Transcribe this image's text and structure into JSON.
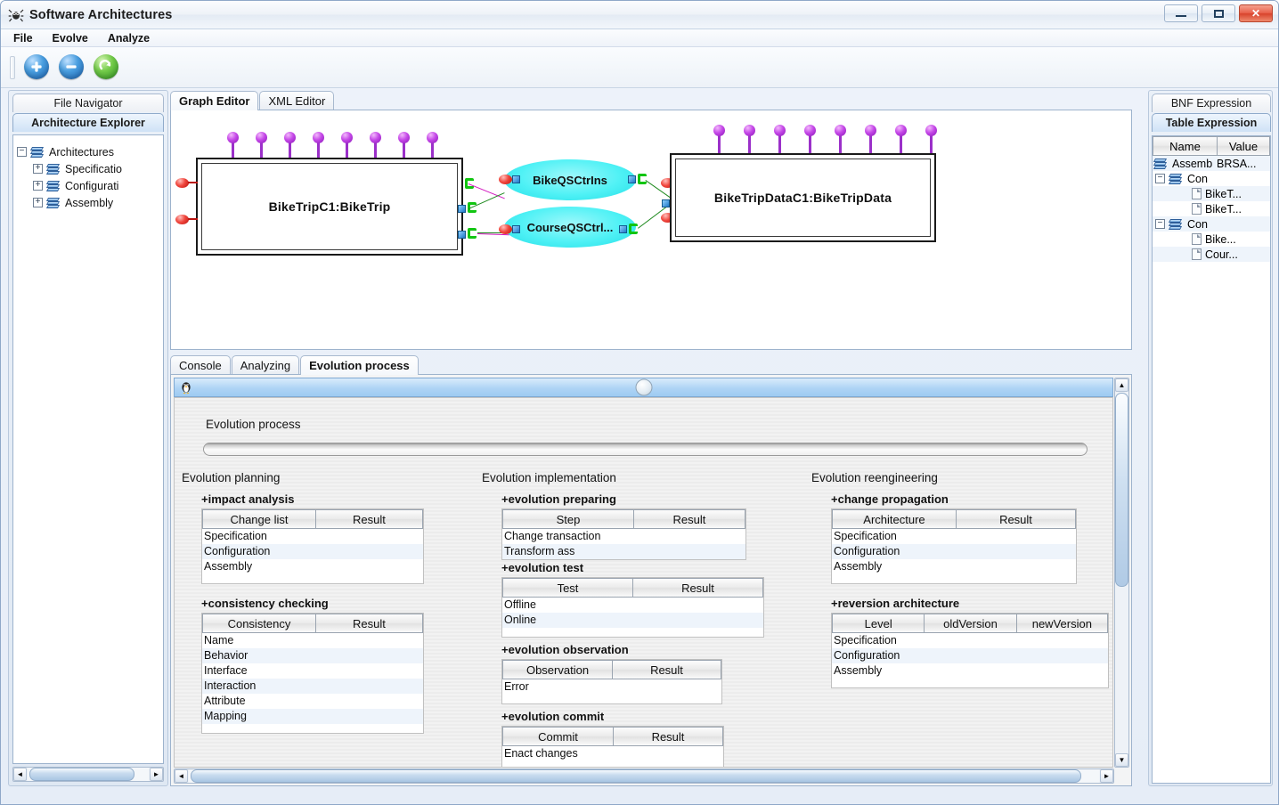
{
  "window": {
    "title": "Software Architectures",
    "app_icon": "spider-icon",
    "controls": {
      "minimize": "–",
      "maximize": "▣",
      "close": "✕"
    }
  },
  "menubar": {
    "items": [
      "File",
      "Evolve",
      "Analyze"
    ]
  },
  "toolbar": {
    "buttons": [
      {
        "name": "add-button",
        "icon": "plus-circle-icon"
      },
      {
        "name": "remove-button",
        "icon": "minus-circle-icon"
      },
      {
        "name": "refresh-button",
        "icon": "refresh-circle-icon"
      }
    ]
  },
  "left_panel": {
    "tabs": [
      {
        "label": "File Navigator",
        "selected": false
      },
      {
        "label": "Architecture Explorer",
        "selected": true
      }
    ],
    "tree": [
      {
        "label": "Architectures",
        "expander": "−",
        "level": 0,
        "icon": "stack-icon"
      },
      {
        "label": "Specificatio",
        "expander": "+",
        "level": 1,
        "icon": "stack-icon"
      },
      {
        "label": "Configurati",
        "expander": "+",
        "level": 1,
        "icon": "stack-icon"
      },
      {
        "label": "Assembly",
        "expander": "+",
        "level": 1,
        "icon": "stack-icon"
      }
    ]
  },
  "editor": {
    "tabs": [
      {
        "label": "Graph Editor",
        "selected": true
      },
      {
        "label": "XML Editor",
        "selected": false
      }
    ],
    "graph": {
      "components": [
        {
          "label": "BikeTripC1:BikeTrip",
          "shape": "rect"
        },
        {
          "label": "BikeTripDataC1:BikeTripData",
          "shape": "rect"
        }
      ],
      "connectors": [
        {
          "label": "BikeQSCtrIns",
          "shape": "ellipse"
        },
        {
          "label": "CourseQSCtrl...",
          "shape": "ellipse"
        }
      ]
    }
  },
  "bottom": {
    "tabs": [
      {
        "label": "Console",
        "selected": false
      },
      {
        "label": "Analyzing",
        "selected": false
      },
      {
        "label": "Evolution process",
        "selected": true
      }
    ],
    "internal_window": {
      "icon": "penguin-icon",
      "heading": "Evolution process",
      "progress": 0
    },
    "columns": [
      {
        "title": "Evolution planning",
        "sections": [
          {
            "title": "+impact analysis",
            "headers": [
              "Change list",
              "Result"
            ],
            "rows": [
              "Specification",
              "Configuration",
              "Assembly"
            ]
          },
          {
            "title": "+consistency checking",
            "headers": [
              "Consistency",
              "Result"
            ],
            "rows": [
              "Name",
              "Behavior",
              "Interface",
              "Interaction",
              "Attribute",
              "Mapping"
            ]
          }
        ]
      },
      {
        "title": "Evolution implementation",
        "sections": [
          {
            "title": "+evolution preparing",
            "headers": [
              "Step",
              "Result"
            ],
            "rows": [
              "Change transaction",
              "Transform ass"
            ]
          },
          {
            "title": "+evolution test",
            "headers": [
              "Test",
              "Result"
            ],
            "rows": [
              "Offline",
              "Online"
            ]
          },
          {
            "title": "+evolution observation",
            "headers": [
              "Observation",
              "Result"
            ],
            "rows": [
              "Error"
            ]
          },
          {
            "title": "+evolution commit",
            "headers": [
              "Commit",
              "Result"
            ],
            "rows": [
              "Enact changes"
            ]
          }
        ]
      },
      {
        "title": "Evolution reengineering",
        "sections": [
          {
            "title": "+change propagation",
            "headers": [
              "Architecture",
              "Result"
            ],
            "rows": [
              "Specification",
              "Configuration",
              "Assembly"
            ]
          },
          {
            "title": "+reversion architecture",
            "headers": [
              "Level",
              "oldVersion",
              "newVersion"
            ],
            "rows": [
              "Specification",
              "Configuration",
              "Assembly"
            ]
          }
        ]
      }
    ]
  },
  "right_panel": {
    "tabs": [
      {
        "label": "BNF Expression",
        "selected": false
      },
      {
        "label": "Table Expression",
        "selected": true
      }
    ],
    "table": {
      "headers": [
        "Name",
        "Value"
      ],
      "rows": [
        {
          "name": "Assemb",
          "value": "BRSA...",
          "level": 0,
          "expander": "",
          "icon": "stack-icon"
        },
        {
          "name": "Con",
          "value": "",
          "level": 0,
          "expander": "−",
          "icon": "stack-icon"
        },
        {
          "name": "",
          "value": "BikeT...",
          "level": 2,
          "expander": "",
          "icon": "doc-icon"
        },
        {
          "name": "",
          "value": "BikeT...",
          "level": 2,
          "expander": "",
          "icon": "doc-icon"
        },
        {
          "name": "Con",
          "value": "",
          "level": 0,
          "expander": "−",
          "icon": "stack-icon"
        },
        {
          "name": "",
          "value": "Bike...",
          "level": 2,
          "expander": "",
          "icon": "doc-icon"
        },
        {
          "name": "",
          "value": "Cour...",
          "level": 2,
          "expander": "",
          "icon": "doc-icon"
        }
      ]
    }
  },
  "scrollbars": {
    "left_h": {
      "left_arrow": "◄",
      "right_arrow": "►"
    },
    "bottom_h": {
      "left_arrow": "◄",
      "right_arrow": "►"
    },
    "bottom_v": {
      "up_arrow": "▲",
      "down_arrow": "▼"
    }
  },
  "colors": {
    "accent": "#4a9fe0",
    "connector_fill": "#4ef1f5",
    "pin": "#c548e8",
    "port_required": "#f0453c",
    "port_provided": "#1f79c8",
    "edge_green": "#1f8a1f",
    "edge_magenta": "#d318c0",
    "selected_tab": "#cfe2f6"
  }
}
